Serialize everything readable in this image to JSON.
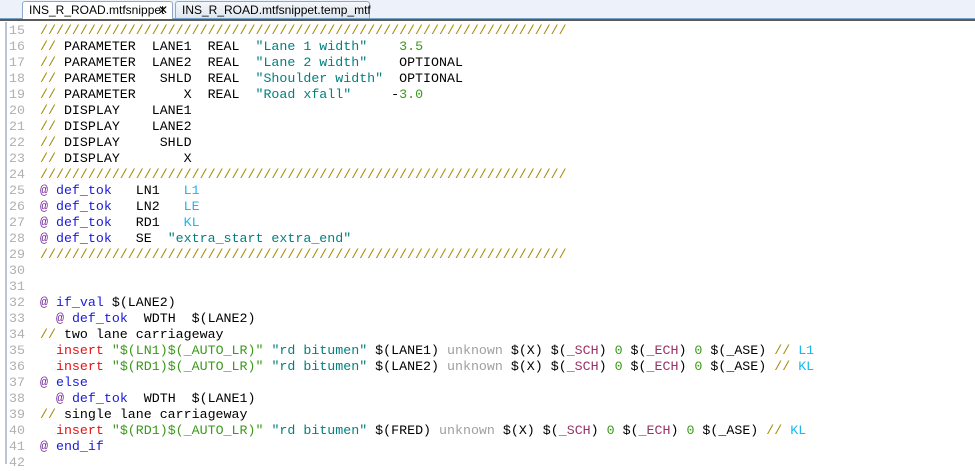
{
  "tabs": [
    {
      "label": "INS_R_ROAD.mtfsnippet",
      "active": true,
      "close": "✕"
    },
    {
      "label": "INS_R_ROAD.mtfsnippet.temp_mtf",
      "active": false
    }
  ],
  "editor": {
    "first_line": 15,
    "lines": [
      [
        [
          "c",
          "//////////////////////////////////////////////////////////////////"
        ]
      ],
      [
        [
          "c",
          "// "
        ],
        [
          "t",
          "PARAMETER  LANE1  REAL  "
        ],
        [
          "s",
          "\"Lane 1 width\""
        ],
        [
          "t",
          "    "
        ],
        [
          "n",
          "3.5"
        ]
      ],
      [
        [
          "c",
          "// "
        ],
        [
          "t",
          "PARAMETER  LANE2  REAL  "
        ],
        [
          "s",
          "\"Lane 2 width\""
        ],
        [
          "t",
          "    OPTIONAL"
        ]
      ],
      [
        [
          "c",
          "// "
        ],
        [
          "t",
          "PARAMETER   SHLD  REAL  "
        ],
        [
          "s",
          "\"Shoulder width\""
        ],
        [
          "t",
          "  OPTIONAL"
        ]
      ],
      [
        [
          "c",
          "// "
        ],
        [
          "t",
          "PARAMETER      X  REAL  "
        ],
        [
          "s",
          "\"Road xfall\""
        ],
        [
          "t",
          "     "
        ],
        [
          "t",
          "-"
        ],
        [
          "n",
          "3.0"
        ]
      ],
      [
        [
          "c",
          "// "
        ],
        [
          "t",
          "DISPLAY    LANE1"
        ]
      ],
      [
        [
          "c",
          "// "
        ],
        [
          "t",
          "DISPLAY    LANE2"
        ]
      ],
      [
        [
          "c",
          "// "
        ],
        [
          "t",
          "DISPLAY     SHLD"
        ]
      ],
      [
        [
          "c",
          "// "
        ],
        [
          "t",
          "DISPLAY        X"
        ]
      ],
      [
        [
          "c",
          "//////////////////////////////////////////////////////////////////"
        ]
      ],
      [
        [
          "k",
          "@ "
        ],
        [
          "kw",
          "def_tok"
        ],
        [
          "t",
          "   LN1   "
        ],
        [
          "cy",
          "L1"
        ]
      ],
      [
        [
          "k",
          "@ "
        ],
        [
          "kw",
          "def_tok"
        ],
        [
          "t",
          "   LN2   "
        ],
        [
          "cy",
          "LE"
        ]
      ],
      [
        [
          "k",
          "@ "
        ],
        [
          "kw",
          "def_tok"
        ],
        [
          "t",
          "   RD1   "
        ],
        [
          "cy",
          "KL"
        ]
      ],
      [
        [
          "k",
          "@ "
        ],
        [
          "kw",
          "def_tok"
        ],
        [
          "t",
          "   SE  "
        ],
        [
          "s",
          "\"extra_start extra_end\""
        ]
      ],
      [
        [
          "c",
          "//////////////////////////////////////////////////////////////////"
        ]
      ],
      [],
      [],
      [
        [
          "k",
          "@ "
        ],
        [
          "kw",
          "if_val"
        ],
        [
          "t",
          " $(LANE2)"
        ]
      ],
      [
        [
          "t",
          "  "
        ],
        [
          "k",
          "@ "
        ],
        [
          "kw",
          "def_tok"
        ],
        [
          "t",
          "  WDTH  $(LANE2)"
        ]
      ],
      [
        [
          "c",
          "// "
        ],
        [
          "t",
          "two lane carriageway"
        ]
      ],
      [
        [
          "t",
          "  "
        ],
        [
          "ins",
          "insert"
        ],
        [
          "t",
          " "
        ],
        [
          "sv",
          "\"$(LN1)$(_AUTO_LR)\""
        ],
        [
          "t",
          " "
        ],
        [
          "s",
          "\"rd bitumen\""
        ],
        [
          "t",
          " $(LANE1) "
        ],
        [
          "u",
          "unknown"
        ],
        [
          "t",
          " $(X) $("
        ],
        [
          "m",
          "_SCH"
        ],
        [
          "t",
          ") "
        ],
        [
          "n",
          "0"
        ],
        [
          "t",
          " $("
        ],
        [
          "m",
          "_ECH"
        ],
        [
          "t",
          ") "
        ],
        [
          "n",
          "0"
        ],
        [
          "t",
          " $(_ASE) "
        ],
        [
          "c",
          "// "
        ],
        [
          "cy",
          "L1"
        ]
      ],
      [
        [
          "t",
          "  "
        ],
        [
          "ins",
          "insert"
        ],
        [
          "t",
          " "
        ],
        [
          "sv",
          "\"$(RD1)$(_AUTO_LR)\""
        ],
        [
          "t",
          " "
        ],
        [
          "s",
          "\"rd bitumen\""
        ],
        [
          "t",
          " $(LANE2) "
        ],
        [
          "u",
          "unknown"
        ],
        [
          "t",
          " $(X) $("
        ],
        [
          "m",
          "_SCH"
        ],
        [
          "t",
          ") "
        ],
        [
          "n",
          "0"
        ],
        [
          "t",
          " $("
        ],
        [
          "m",
          "_ECH"
        ],
        [
          "t",
          ") "
        ],
        [
          "n",
          "0"
        ],
        [
          "t",
          " $(_ASE) "
        ],
        [
          "c",
          "// "
        ],
        [
          "cy",
          "KL"
        ]
      ],
      [
        [
          "k",
          "@ "
        ],
        [
          "kw",
          "else"
        ]
      ],
      [
        [
          "t",
          "  "
        ],
        [
          "k",
          "@ "
        ],
        [
          "kw",
          "def_tok"
        ],
        [
          "t",
          "  WDTH  $(LANE1)"
        ]
      ],
      [
        [
          "c",
          "// "
        ],
        [
          "t",
          "single lane carriageway"
        ]
      ],
      [
        [
          "t",
          "  "
        ],
        [
          "ins",
          "insert"
        ],
        [
          "t",
          " "
        ],
        [
          "sv",
          "\"$(RD1)$(_AUTO_LR)\""
        ],
        [
          "t",
          " "
        ],
        [
          "s",
          "\"rd bitumen\""
        ],
        [
          "t",
          " $(FRED) "
        ],
        [
          "u",
          "unknown"
        ],
        [
          "t",
          " $(X) $("
        ],
        [
          "m",
          "_SCH"
        ],
        [
          "t",
          ") "
        ],
        [
          "n",
          "0"
        ],
        [
          "t",
          " $("
        ],
        [
          "m",
          "_ECH"
        ],
        [
          "t",
          ") "
        ],
        [
          "n",
          "0"
        ],
        [
          "t",
          " $(_ASE) "
        ],
        [
          "c",
          "// "
        ],
        [
          "cy",
          "KL"
        ]
      ],
      [
        [
          "k",
          "@ "
        ],
        [
          "kw",
          "end_if"
        ]
      ],
      []
    ]
  }
}
